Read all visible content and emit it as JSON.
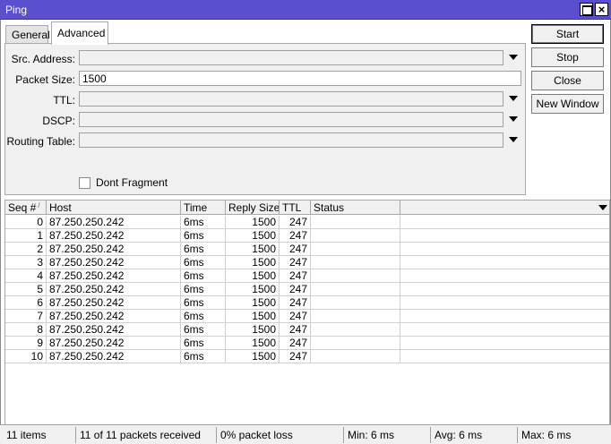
{
  "window": {
    "title": "Ping"
  },
  "tabs": [
    {
      "label": "General"
    },
    {
      "label": "Advanced"
    }
  ],
  "form": {
    "src_address": {
      "label": "Src. Address:",
      "value": ""
    },
    "packet_size": {
      "label": "Packet Size:",
      "value": "1500"
    },
    "ttl": {
      "label": "TTL:",
      "value": ""
    },
    "dscp": {
      "label": "DSCP:",
      "value": ""
    },
    "routing_table": {
      "label": "Routing Table:",
      "value": ""
    },
    "dont_fragment": {
      "label": "Dont Fragment",
      "checked": false
    }
  },
  "buttons": {
    "start": "Start",
    "stop": "Stop",
    "close": "Close",
    "new_window": "New Window"
  },
  "table": {
    "columns": [
      "Seq #",
      "Host",
      "Time",
      "Reply Size",
      "TTL",
      "Status"
    ],
    "rows": [
      {
        "seq": "0",
        "host": "87.250.250.242",
        "time": "6ms",
        "reply_size": "1500",
        "ttl": "247",
        "status": ""
      },
      {
        "seq": "1",
        "host": "87.250.250.242",
        "time": "6ms",
        "reply_size": "1500",
        "ttl": "247",
        "status": ""
      },
      {
        "seq": "2",
        "host": "87.250.250.242",
        "time": "6ms",
        "reply_size": "1500",
        "ttl": "247",
        "status": ""
      },
      {
        "seq": "3",
        "host": "87.250.250.242",
        "time": "6ms",
        "reply_size": "1500",
        "ttl": "247",
        "status": ""
      },
      {
        "seq": "4",
        "host": "87.250.250.242",
        "time": "6ms",
        "reply_size": "1500",
        "ttl": "247",
        "status": ""
      },
      {
        "seq": "5",
        "host": "87.250.250.242",
        "time": "6ms",
        "reply_size": "1500",
        "ttl": "247",
        "status": ""
      },
      {
        "seq": "6",
        "host": "87.250.250.242",
        "time": "6ms",
        "reply_size": "1500",
        "ttl": "247",
        "status": ""
      },
      {
        "seq": "7",
        "host": "87.250.250.242",
        "time": "6ms",
        "reply_size": "1500",
        "ttl": "247",
        "status": ""
      },
      {
        "seq": "8",
        "host": "87.250.250.242",
        "time": "6ms",
        "reply_size": "1500",
        "ttl": "247",
        "status": ""
      },
      {
        "seq": "9",
        "host": "87.250.250.242",
        "time": "6ms",
        "reply_size": "1500",
        "ttl": "247",
        "status": ""
      },
      {
        "seq": "10",
        "host": "87.250.250.242",
        "time": "6ms",
        "reply_size": "1500",
        "ttl": "247",
        "status": ""
      }
    ]
  },
  "status": {
    "items": "11 items",
    "received": "11 of 11 packets received",
    "loss": "0% packet loss",
    "min": "Min: 6 ms",
    "avg": "Avg: 6 ms",
    "max": "Max: 6 ms"
  },
  "colors": {
    "titlebar": "#5a4fcf"
  },
  "icons": [
    "maximize-icon",
    "close-icon",
    "dropdown-arrow-icon",
    "sort-indicator-icon"
  ]
}
